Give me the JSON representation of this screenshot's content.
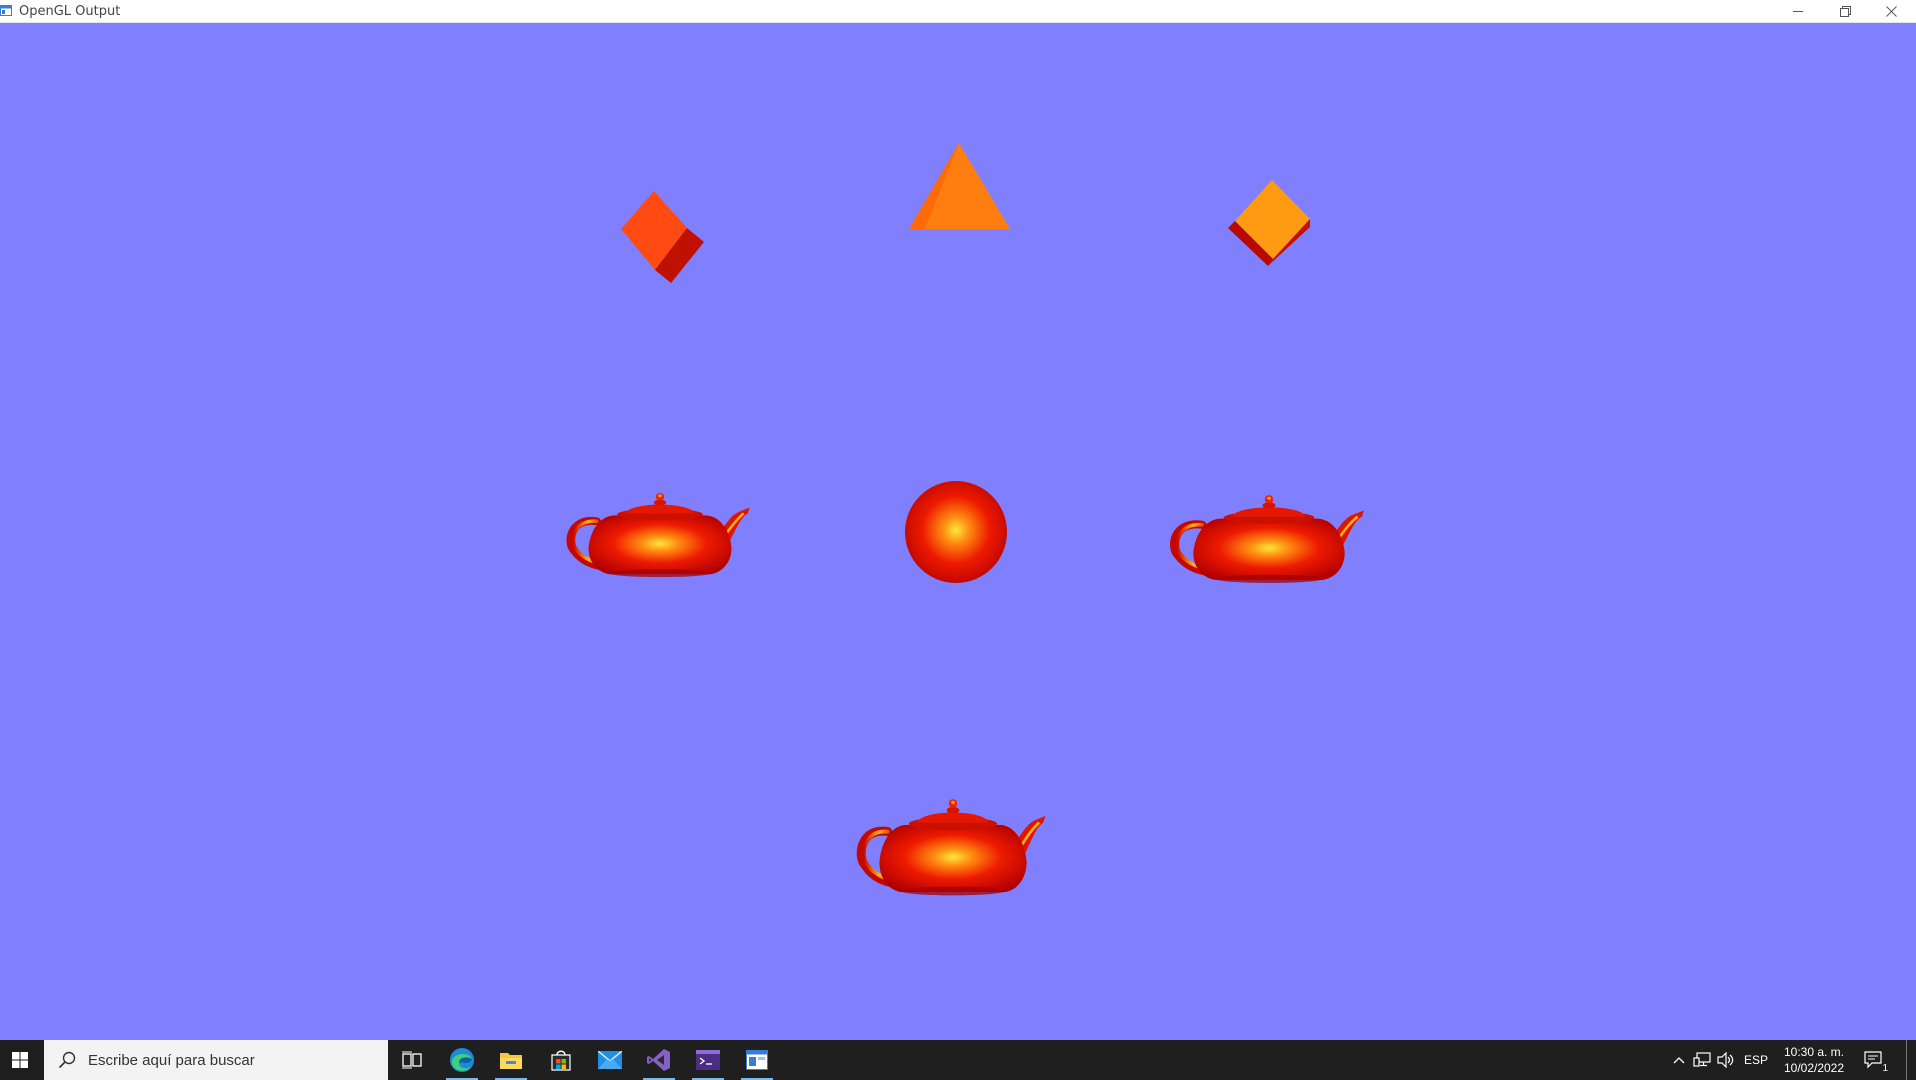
{
  "window": {
    "title": "OpenGL Output"
  },
  "viewport": {
    "background_color": "#8080ff",
    "objects": [
      {
        "name": "red-cube",
        "shape": "cube",
        "color": "#ff4010"
      },
      {
        "name": "orange-pyramid",
        "shape": "pyramid",
        "color": "#ff7a10"
      },
      {
        "name": "amber-cube",
        "shape": "cube",
        "color": "#ff9a10"
      },
      {
        "name": "teapot-left",
        "shape": "teapot",
        "color": "#ee1100"
      },
      {
        "name": "sphere",
        "shape": "sphere",
        "color": "#ee1100"
      },
      {
        "name": "teapot-right",
        "shape": "teapot",
        "color": "#ee1100"
      },
      {
        "name": "teapot-bottom",
        "shape": "teapot",
        "color": "#ee1100"
      }
    ]
  },
  "taskbar": {
    "search_placeholder": "Escribe aquí para buscar",
    "apps": [
      {
        "name": "task-view-icon"
      },
      {
        "name": "edge-icon",
        "running": true
      },
      {
        "name": "file-explorer-icon",
        "running": true
      },
      {
        "name": "store-icon"
      },
      {
        "name": "mail-icon"
      },
      {
        "name": "visual-studio-icon",
        "running": true
      },
      {
        "name": "console-icon",
        "running": true
      },
      {
        "name": "opengl-window-icon",
        "running": true
      }
    ],
    "tray": {
      "language": "ESP",
      "time": "10:30 a. m.",
      "date": "10/02/2022",
      "notification_count": "1"
    }
  }
}
